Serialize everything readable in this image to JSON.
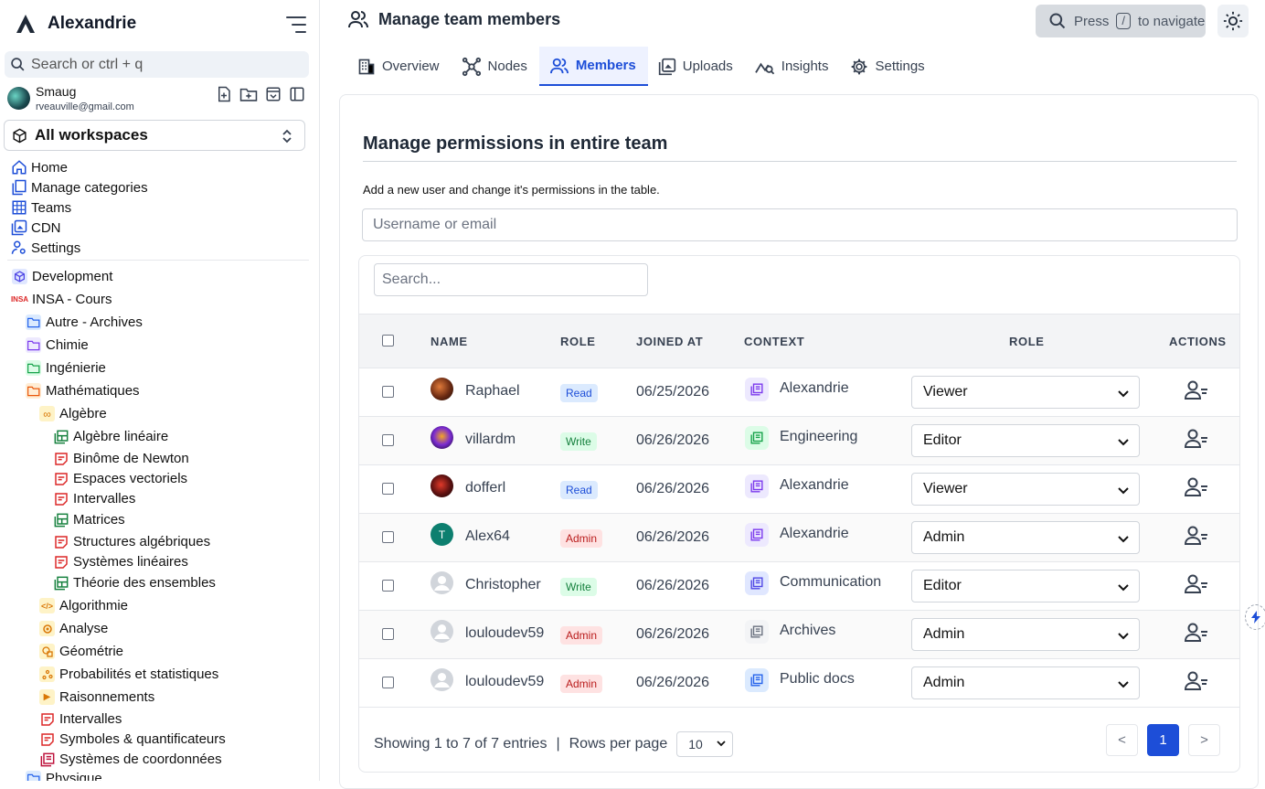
{
  "app": {
    "name": "Alexandrie"
  },
  "search": {
    "placeholder": "Search or ctrl + q"
  },
  "user": {
    "name": "Smaug",
    "email": "rveauville@gmail.com"
  },
  "workspace": {
    "label": "All workspaces"
  },
  "nav": [
    "Home",
    "Manage categories",
    "Teams",
    "CDN",
    "Settings"
  ],
  "tree": {
    "development": "Development",
    "insa": "INSA - Cours",
    "autre": "Autre - Archives",
    "chimie": "Chimie",
    "ingenierie": "Ingénierie",
    "maths": "Mathématiques",
    "algebre": "Algèbre",
    "algebre_lineaire": "Algèbre linéaire",
    "binome": "Binôme de Newton",
    "espaces": "Espaces vectoriels",
    "intervalles1": "Intervalles",
    "matrices": "Matrices",
    "structures": "Structures algébriques",
    "systemes": "Systèmes linéaires",
    "theorie": "Théorie des ensembles",
    "algorithmie": "Algorithmie",
    "analyse": "Analyse",
    "geometrie": "Géométrie",
    "probas": "Probabilités et statistiques",
    "raisonnements": "Raisonnements",
    "intervalles2": "Intervalles",
    "symboles": "Symboles & quantificateurs",
    "coordonnees": "Systèmes de coordonnées",
    "physique": "Physique"
  },
  "header": {
    "title": "Manage team members",
    "press": "Press",
    "key": "/",
    "navigate": "to navigate"
  },
  "tabs": [
    "Overview",
    "Nodes",
    "Members",
    "Uploads",
    "Insights",
    "Settings"
  ],
  "panel": {
    "title": "Manage permissions in entire team",
    "description": "Add a new user and change it's permissions in the table.",
    "user_placeholder": "Username or email",
    "search_placeholder": "Search..."
  },
  "table": {
    "headers": {
      "name": "NAME",
      "role": "ROLE",
      "joined": "JOINED AT",
      "context": "CONTEXT",
      "role2": "ROLE",
      "actions": "ACTIONS"
    },
    "rows": [
      {
        "name": "Raphael",
        "badge": "Read",
        "joined": "06/25/2026",
        "context": "Alexandrie",
        "role": "Viewer"
      },
      {
        "name": "villardm",
        "badge": "Write",
        "joined": "06/26/2026",
        "context": "Engineering",
        "role": "Editor"
      },
      {
        "name": "dofferl",
        "badge": "Read",
        "joined": "06/26/2026",
        "context": "Alexandrie",
        "role": "Viewer"
      },
      {
        "name": "Alex64",
        "badge": "Admin",
        "joined": "06/26/2026",
        "context": "Alexandrie",
        "role": "Admin",
        "initial": "T"
      },
      {
        "name": "Christopher",
        "badge": "Write",
        "joined": "06/26/2026",
        "context": "Communication",
        "role": "Editor"
      },
      {
        "name": "louloudev59",
        "badge": "Admin",
        "joined": "06/26/2026",
        "context": "Archives",
        "role": "Admin"
      },
      {
        "name": "louloudev59",
        "badge": "Admin",
        "joined": "06/26/2026",
        "context": "Public docs",
        "role": "Admin"
      }
    ]
  },
  "footer": {
    "showing": "Showing 1 to 7 of 7 entries",
    "rows_label": "Rows per page",
    "rows_value": "10",
    "prev": "<",
    "page": "1",
    "next": ">"
  }
}
